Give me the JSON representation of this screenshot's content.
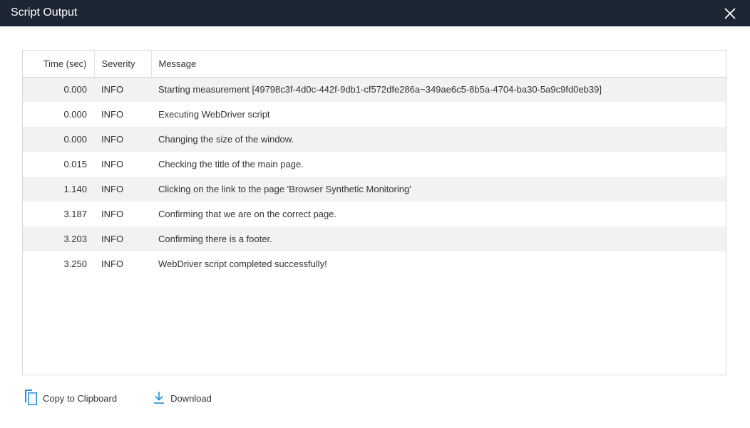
{
  "dialog": {
    "title": "Script Output"
  },
  "table": {
    "headers": {
      "time": "Time (sec)",
      "severity": "Severity",
      "message": "Message"
    },
    "rows": [
      {
        "time": "0.000",
        "severity": "INFO",
        "message": "Starting measurement [49798c3f-4d0c-442f-9db1-cf572dfe286a~349ae6c5-8b5a-4704-ba30-5a9c9fd0eb39]"
      },
      {
        "time": "0.000",
        "severity": "INFO",
        "message": "Executing WebDriver script"
      },
      {
        "time": "0.000",
        "severity": "INFO",
        "message": "Changing the size of the window."
      },
      {
        "time": "0.015",
        "severity": "INFO",
        "message": "Checking the title of the main page."
      },
      {
        "time": "1.140",
        "severity": "INFO",
        "message": "Clicking on the link to the page 'Browser Synthetic Monitoring'"
      },
      {
        "time": "3.187",
        "severity": "INFO",
        "message": "Confirming that we are on the correct page."
      },
      {
        "time": "3.203",
        "severity": "INFO",
        "message": "Confirming there is a footer."
      },
      {
        "time": "3.250",
        "severity": "INFO",
        "message": "WebDriver script completed successfully!"
      }
    ]
  },
  "actions": {
    "copy_label": "Copy to Clipboard",
    "download_label": "Download"
  },
  "colors": {
    "titlebar": "#1d2635",
    "accent": "#1a8fe3"
  },
  "icons": {
    "close": "close-icon",
    "copy": "copy-icon",
    "download": "download-icon"
  }
}
